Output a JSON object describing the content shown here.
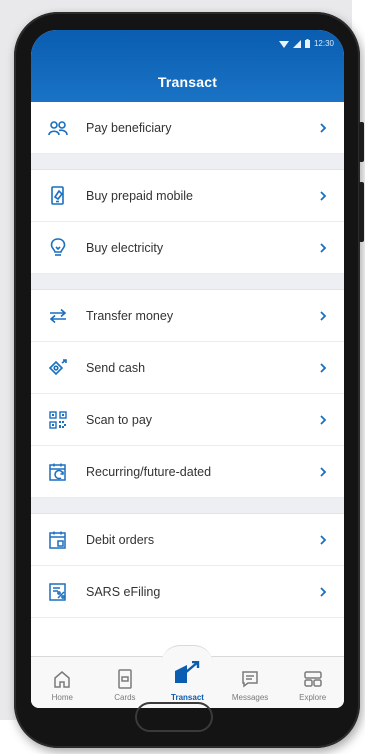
{
  "status_bar": {
    "time": "12:30"
  },
  "header": {
    "title": "Transact"
  },
  "groups": [
    {
      "items": [
        {
          "label": "Pay beneficiary",
          "icon": "beneficiary-icon"
        }
      ]
    },
    {
      "items": [
        {
          "label": "Buy prepaid mobile",
          "icon": "prepaid-mobile-icon"
        },
        {
          "label": "Buy electricity",
          "icon": "lightbulb-icon"
        }
      ]
    },
    {
      "items": [
        {
          "label": "Transfer money",
          "icon": "transfer-arrows-icon"
        },
        {
          "label": "Send cash",
          "icon": "send-cash-icon"
        },
        {
          "label": "Scan to pay",
          "icon": "qr-code-icon"
        },
        {
          "label": "Recurring/future-dated",
          "icon": "recurring-calendar-icon"
        }
      ]
    },
    {
      "items": [
        {
          "label": "Debit orders",
          "icon": "debit-order-calendar-icon"
        },
        {
          "label": "SARS eFiling",
          "icon": "efiling-document-icon"
        }
      ]
    }
  ],
  "bottom_nav": [
    {
      "label": "Home",
      "icon": "home-icon",
      "active": false
    },
    {
      "label": "Cards",
      "icon": "cards-icon",
      "active": false
    },
    {
      "label": "Transact",
      "icon": "transact-icon",
      "active": true
    },
    {
      "label": "Messages",
      "icon": "messages-icon",
      "active": false
    },
    {
      "label": "Explore",
      "icon": "explore-icon",
      "active": false
    }
  ],
  "colors": {
    "brand": "#0a5db0",
    "icon": "#1a6fc0",
    "text": "#333333"
  }
}
